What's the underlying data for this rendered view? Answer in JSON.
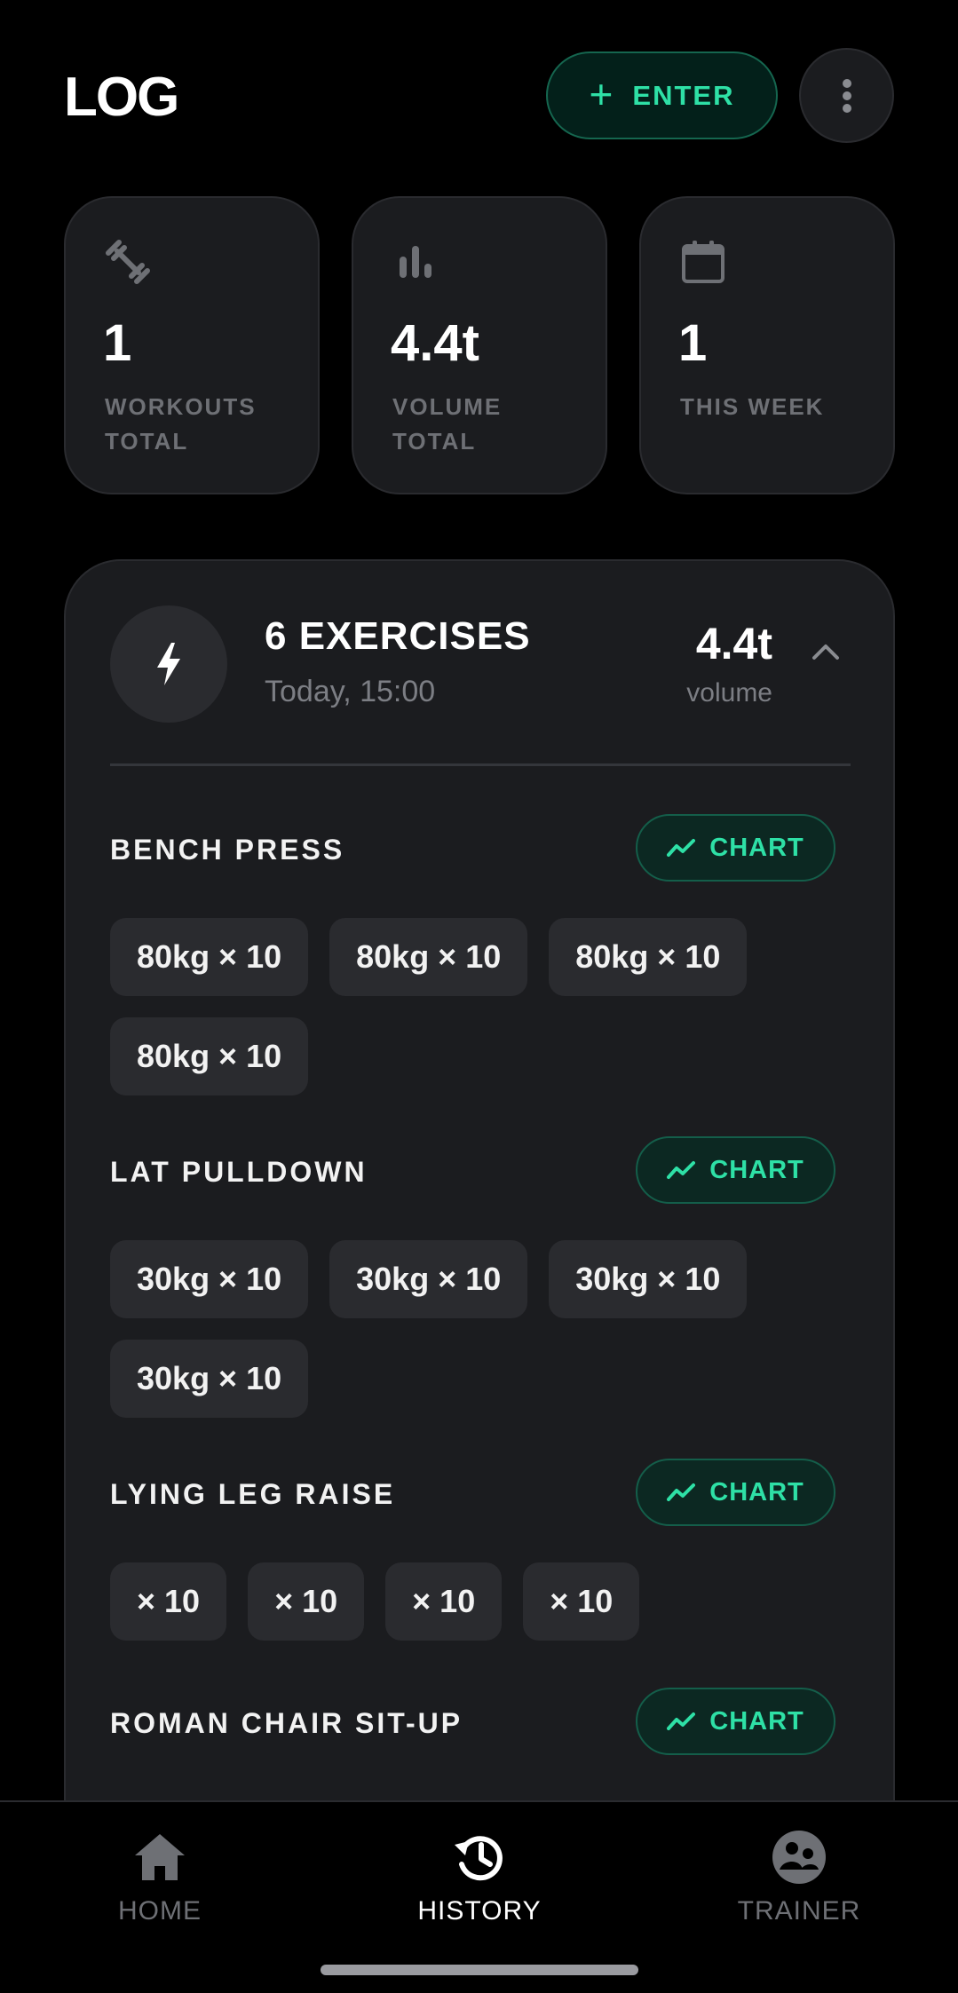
{
  "header": {
    "title": "LOG",
    "enter_label": "ENTER"
  },
  "stats": [
    {
      "icon": "dumbbell-icon",
      "value": "1",
      "label": "WORKOUTS TOTAL"
    },
    {
      "icon": "bar-chart-icon",
      "value": "4.4t",
      "label": "VOLUME TOTAL"
    },
    {
      "icon": "calendar-icon",
      "value": "1",
      "label": "THIS WEEK"
    }
  ],
  "workout": {
    "title": "6 EXERCISES",
    "time": "Today, 15:00",
    "volume": "4.4t",
    "volume_label": "volume",
    "chart_label": "CHART",
    "exercises": [
      {
        "name": "BENCH PRESS",
        "sets": [
          "80kg × 10",
          "80kg × 10",
          "80kg × 10",
          "80kg × 10"
        ]
      },
      {
        "name": "LAT PULLDOWN",
        "sets": [
          "30kg × 10",
          "30kg × 10",
          "30kg × 10",
          "30kg × 10"
        ]
      },
      {
        "name": "LYING LEG RAISE",
        "sets": [
          "× 10",
          "× 10",
          "× 10",
          "× 10"
        ]
      },
      {
        "name": "ROMAN CHAIR SIT-UP",
        "sets": []
      }
    ]
  },
  "nav": [
    {
      "label": "HOME",
      "icon": "home-icon",
      "active": false
    },
    {
      "label": "HISTORY",
      "icon": "history-icon",
      "active": true
    },
    {
      "label": "TRAINER",
      "icon": "trainer-icon",
      "active": false
    }
  ],
  "colors": {
    "accent": "#2ee0a6",
    "card": "#1b1c1f",
    "chip": "#2a2b2f",
    "muted": "#6e7075"
  }
}
